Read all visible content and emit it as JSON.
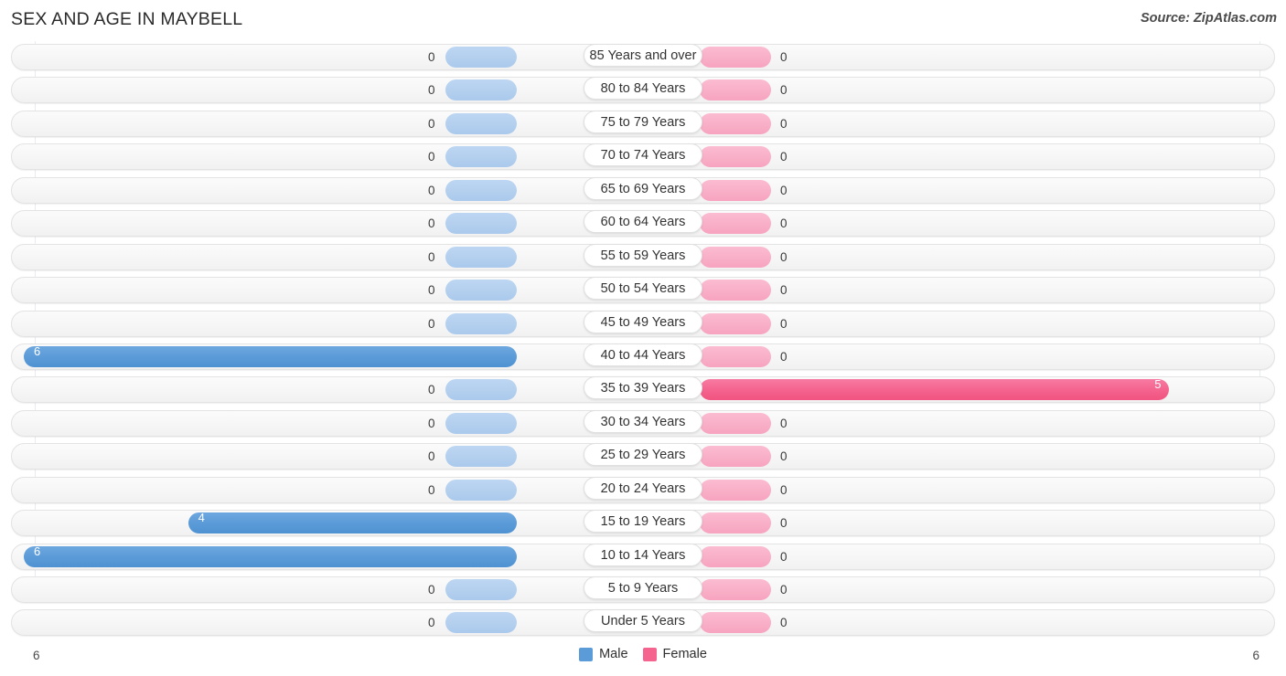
{
  "header": {
    "title": "SEX AND AGE IN MAYBELL",
    "source": "Source: ZipAtlas.com"
  },
  "legend": {
    "male": {
      "label": "Male",
      "color": "#5b9bd8",
      "icon": "male-swatch"
    },
    "female": {
      "label": "Female",
      "color": "#f4648f",
      "icon": "female-swatch"
    }
  },
  "axis": {
    "left_label": "6",
    "right_label": "6",
    "max": 6
  },
  "chart_data": {
    "type": "bar",
    "title": "SEX AND AGE IN MAYBELL",
    "subtitle": "Source: ZipAtlas.com",
    "orientation": "horizontal-diverging",
    "xlabel": "",
    "ylabel": "",
    "xlim": [
      6,
      6
    ],
    "grid": true,
    "legend_position": "bottom-center",
    "categories": [
      "85 Years and over",
      "80 to 84 Years",
      "75 to 79 Years",
      "70 to 74 Years",
      "65 to 69 Years",
      "60 to 64 Years",
      "55 to 59 Years",
      "50 to 54 Years",
      "45 to 49 Years",
      "40 to 44 Years",
      "35 to 39 Years",
      "30 to 34 Years",
      "25 to 29 Years",
      "20 to 24 Years",
      "15 to 19 Years",
      "10 to 14 Years",
      "5 to 9 Years",
      "Under 5 Years"
    ],
    "series": [
      {
        "name": "Male",
        "color": "#5b9bd8",
        "values": [
          0,
          0,
          0,
          0,
          0,
          0,
          0,
          0,
          0,
          6,
          0,
          0,
          0,
          0,
          4,
          6,
          0,
          0
        ]
      },
      {
        "name": "Female",
        "color": "#f4648f",
        "values": [
          0,
          0,
          0,
          0,
          0,
          0,
          0,
          0,
          0,
          0,
          5,
          0,
          0,
          0,
          0,
          0,
          0,
          0
        ]
      }
    ]
  }
}
